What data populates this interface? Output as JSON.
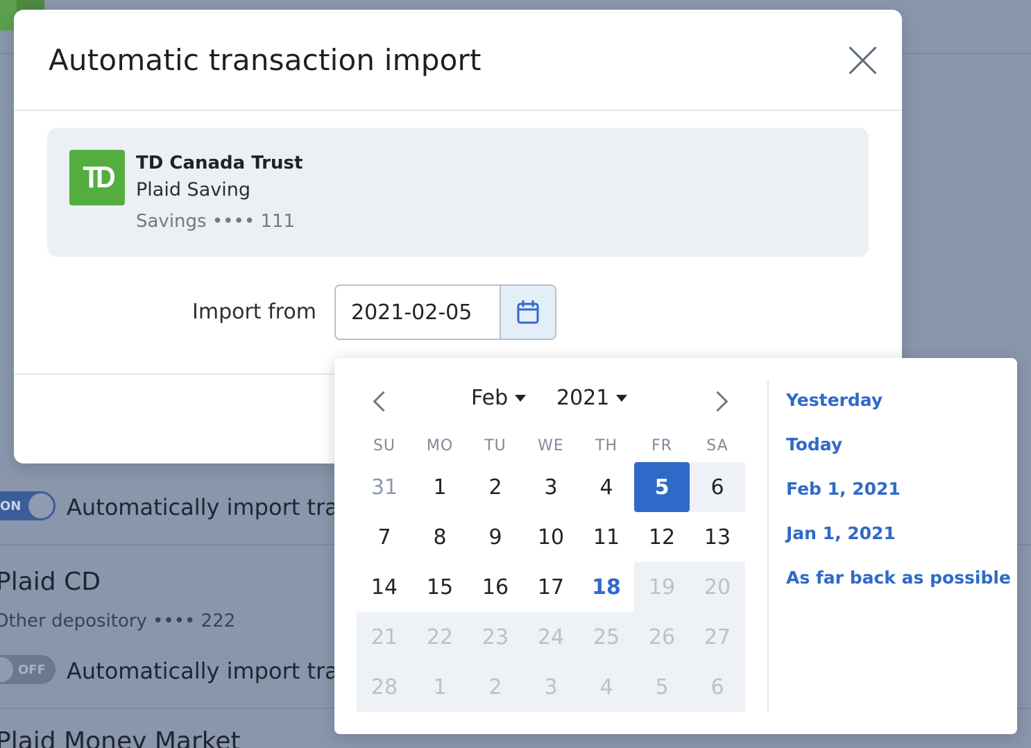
{
  "background": {
    "accounts": [
      {
        "title": "Plaid CD",
        "subtitle": "Other depository",
        "mask": "•••• 222",
        "toggle": "OFF",
        "text": "Automatically import trans"
      },
      {
        "title": "Plaid Money Market"
      }
    ],
    "partial_row": {
      "toggle": "ON",
      "text": "Automatically import trans"
    }
  },
  "modal": {
    "title": "Automatic transaction import",
    "account": {
      "logo_text": "TD",
      "bank": "TD Canada Trust",
      "name": "Plaid Saving",
      "meta": "Savings •••• 111"
    },
    "import_label": "Import from",
    "import_value": "2021-02-05"
  },
  "calendar": {
    "month": "Feb",
    "year": "2021",
    "weekdays": [
      "SU",
      "MO",
      "TU",
      "WE",
      "TH",
      "FR",
      "SA"
    ],
    "weeks": [
      [
        "31",
        "1",
        "2",
        "3",
        "4",
        "5",
        "6"
      ],
      [
        "7",
        "8",
        "9",
        "10",
        "11",
        "12",
        "13"
      ],
      [
        "14",
        "15",
        "16",
        "17",
        "18",
        "19",
        "20"
      ],
      [
        "21",
        "22",
        "23",
        "24",
        "25",
        "26",
        "27"
      ],
      [
        "28",
        "1",
        "2",
        "3",
        "4",
        "5",
        "6"
      ]
    ],
    "selected_day": "5",
    "today_day": "18",
    "shortcuts": [
      "Yesterday",
      "Today",
      "Feb 1, 2021",
      "Jan 1, 2021",
      "As far back as possible"
    ]
  },
  "colors": {
    "accent": "#2f6ac9",
    "td_green": "#54ad3f",
    "overlay": "#8996ac"
  }
}
